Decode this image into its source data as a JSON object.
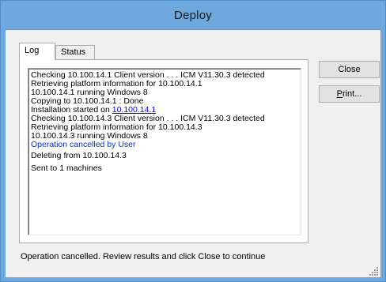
{
  "window": {
    "title": "Deploy"
  },
  "tabs": [
    {
      "label": "Log",
      "active": true
    },
    {
      "label": "Status",
      "active": false
    }
  ],
  "log": {
    "lines": [
      {
        "text": "Checking 10.100.14.1 Client version . . . ICM V11.30.3  detected"
      },
      {
        "text": "Retrieving platform information for 10.100.14.1"
      },
      {
        "text": "10.100.14.1 running Windows 8"
      },
      {
        "text": "Copying to 10.100.14.1 : Done"
      },
      {
        "prefix": "Installation started on ",
        "link": "10.100.14.1"
      },
      {
        "text": "Checking 10.100.14.3 Client version . . . ICM V11.30.3  detected"
      },
      {
        "text": "Retrieving platform information for 10.100.14.3"
      },
      {
        "text": "10.100.14.3 running Windows 8"
      },
      {
        "text": "Operation cancelled by User",
        "color": "#0033cc"
      },
      {
        "text": "Deleting  from 10.100.14.3"
      },
      {
        "text": "Sent to 1 machines"
      }
    ]
  },
  "buttons": {
    "close_label": "Close",
    "print_label_pre": "",
    "print_label_ul": "P",
    "print_label_post": "rint..."
  },
  "status_text": "Operation cancelled. Review results and click Close to continue"
}
